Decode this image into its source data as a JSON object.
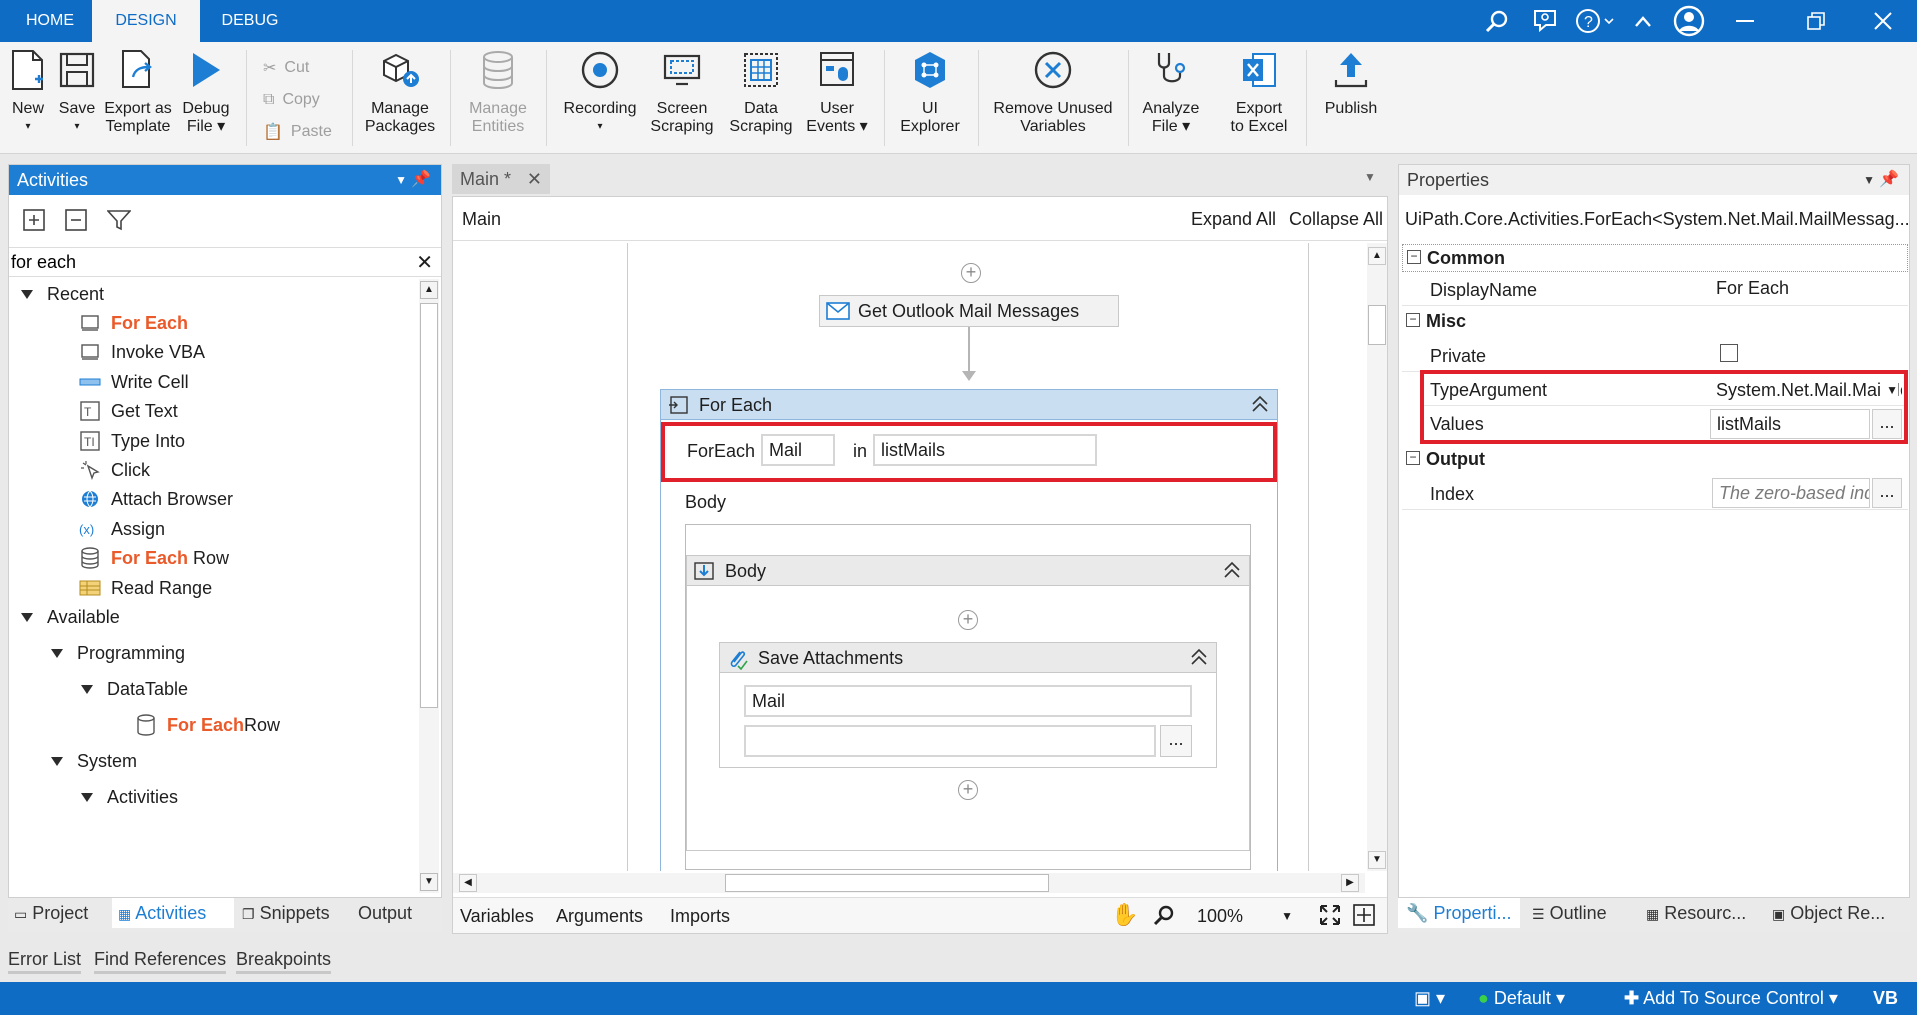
{
  "ribbon_tabs": [
    "HOME",
    "DESIGN",
    "DEBUG"
  ],
  "ribbon_buttons": {
    "new": "New",
    "save": "Save",
    "export_template_1": "Export as",
    "export_template_2": "Template",
    "debug_1": "Debug",
    "debug_2": "File",
    "cut": "Cut",
    "copy": "Copy",
    "paste": "Paste",
    "manage_packages_1": "Manage",
    "manage_packages_2": "Packages",
    "manage_entities_1": "Manage",
    "manage_entities_2": "Entities",
    "recording": "Recording",
    "screen_scraping_1": "Screen",
    "screen_scraping_2": "Scraping",
    "data_scraping_1": "Data",
    "data_scraping_2": "Scraping",
    "user_events_1": "User",
    "user_events_2": "Events",
    "ui_explorer_1": "UI",
    "ui_explorer_2": "Explorer",
    "remove_unused_1": "Remove Unused",
    "remove_unused_2": "Variables",
    "analyze_1": "Analyze",
    "analyze_2": "File",
    "export_excel_1": "Export",
    "export_excel_2": "to Excel",
    "publish": "Publish"
  },
  "activities_panel": {
    "title": "Activities",
    "search_value": "for each",
    "tree": {
      "recent": "Recent",
      "items": [
        {
          "hl": "For Each",
          "rest": "",
          "icon": "for-each-icon"
        },
        {
          "hl": "",
          "rest": "Invoke VBA",
          "icon": "invoke-vba-icon"
        },
        {
          "hl": "",
          "rest": "Write Cell",
          "icon": "write-cell-icon"
        },
        {
          "hl": "",
          "rest": "Get Text",
          "icon": "get-text-icon"
        },
        {
          "hl": "",
          "rest": "Type Into",
          "icon": "type-into-icon"
        },
        {
          "hl": "",
          "rest": "Click",
          "icon": "click-icon"
        },
        {
          "hl": "",
          "rest": "Attach Browser",
          "icon": "globe-icon"
        },
        {
          "hl": "",
          "rest": "Assign",
          "icon": "assign-icon"
        },
        {
          "hl": "For Each",
          "rest": " Row",
          "icon": "for-each-row-icon"
        },
        {
          "hl": "",
          "rest": "Read Range",
          "icon": "read-range-icon"
        }
      ],
      "available": "Available",
      "programming": "Programming",
      "datatable": "DataTable",
      "dt_item_hl": "For Each",
      "dt_item_rest": " Row",
      "system": "System",
      "activities": "Activities"
    }
  },
  "left_bottom_tabs": [
    "Project",
    "Activities",
    "Snippets",
    "Output"
  ],
  "bottom_bar_tabs": [
    "Error List",
    "Find References",
    "Breakpoints"
  ],
  "designer": {
    "tab": "Main *",
    "breadcrumb": "Main",
    "expand_all": "Expand All",
    "collapse_all": "Collapse All",
    "get_outlook": "Get Outlook Mail Messages",
    "for_each_title": "For Each",
    "foreach_label": "ForEach",
    "item_var": "Mail",
    "in_label": "in",
    "collection": "listMails",
    "body_label": "Body",
    "body_seq_title": "Body",
    "save_attach_title": "Save Attachments",
    "save_attach_mail": "Mail",
    "ellipsis": "...",
    "bottom_tabs": [
      "Variables",
      "Arguments",
      "Imports"
    ],
    "zoom": "100%"
  },
  "properties": {
    "title": "Properties",
    "type_name": "UiPath.Core.Activities.ForEach<System.Net.Mail.MailMessag...",
    "sections": {
      "common": "Common",
      "misc": "Misc",
      "output": "Output"
    },
    "display_name_label": "DisplayName",
    "display_name_value": "For Each",
    "private_label": "Private",
    "type_argument_label": "TypeArgument",
    "type_argument_value": "System.Net.Mail.MailMessage",
    "values_label": "Values",
    "values_value": "listMails",
    "index_label": "Index",
    "index_placeholder": "The zero-based index",
    "ellipsis": "..."
  },
  "right_bottom_tabs": [
    "Properti...",
    "Outline",
    "Resourc...",
    "Object Re..."
  ],
  "status_bar": {
    "default": "Default",
    "source_control": "Add To Source Control",
    "lang": "VB"
  },
  "colors": {
    "accent": "#0f6cc5",
    "highlight_text": "#ea5a2a",
    "callout_red": "#e0202a",
    "activity_header": "#c9def1"
  }
}
